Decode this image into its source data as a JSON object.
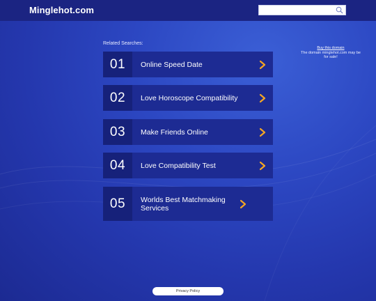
{
  "header": {
    "logo": "Minglehot.com",
    "search": {
      "value": "",
      "placeholder": ""
    }
  },
  "related": {
    "label": "Related Searches:",
    "items": [
      {
        "number": "01",
        "label": "Online Speed Date"
      },
      {
        "number": "02",
        "label": "Love Horoscope Compatibility"
      },
      {
        "number": "03",
        "label": "Make Friends Online"
      },
      {
        "number": "04",
        "label": "Love Compatibility Test"
      },
      {
        "number": "05",
        "label": "Worlds Best Matchmaking Services"
      }
    ]
  },
  "sidebar": {
    "buy_link": "Buy this domain",
    "sale_text": "The domain minglehot.com may be for sale!"
  },
  "footer": {
    "privacy": "Privacy Policy"
  },
  "colors": {
    "accent_arrow": "#f5a623",
    "header_bg": "#1b2482",
    "item_bg": "#1d2b93",
    "number_bg": "#16217a"
  }
}
